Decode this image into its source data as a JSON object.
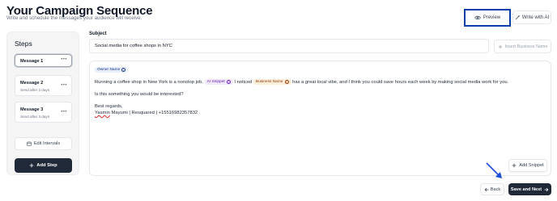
{
  "header": {
    "title": "Your Campaign Sequence",
    "subtitle": "Write and schedule the messages your audience will receive."
  },
  "toolbar": {
    "preview_label": "Preview",
    "write_ai_label": "Write with AI"
  },
  "steps": {
    "title": "Steps",
    "items": [
      {
        "name": "Message 1",
        "sub": "",
        "active": true
      },
      {
        "name": "Message 2",
        "sub": "Send after 2 days"
      },
      {
        "name": "Message 3",
        "sub": "Send after 3 days"
      }
    ],
    "edit_intervals_label": "Edit Intervals",
    "add_step_label": "Add Step"
  },
  "subject": {
    "label": "Subject",
    "value": "Social media for coffee shops in NYC",
    "insert_business_name_label": "Insert Business Name"
  },
  "editor": {
    "owner_chip": "Owner Name",
    "line1_start": "Running a coffee shop in New York is a nonstop job.",
    "ai_chip": "AI Snippet",
    "line1_mid": "I noticed",
    "business_chip": "Business Name",
    "line1_end": "has a great local vibe, and I think you could save hours each week by making social media work for you.",
    "line2": "Is this something you would be interested?",
    "line3": "Best regards,",
    "sig_name": "Yasmin",
    "sig_rest": " Mayumi | Resquared | +15516982357832",
    "add_snippet_label": "Add Snippet"
  },
  "footer": {
    "back_label": "Back",
    "next_label": "Save and Next"
  },
  "colors": {
    "highlight": "#0b3fa8",
    "primary": "#1f2937",
    "annotation_arrow": "#1d4ed8"
  }
}
